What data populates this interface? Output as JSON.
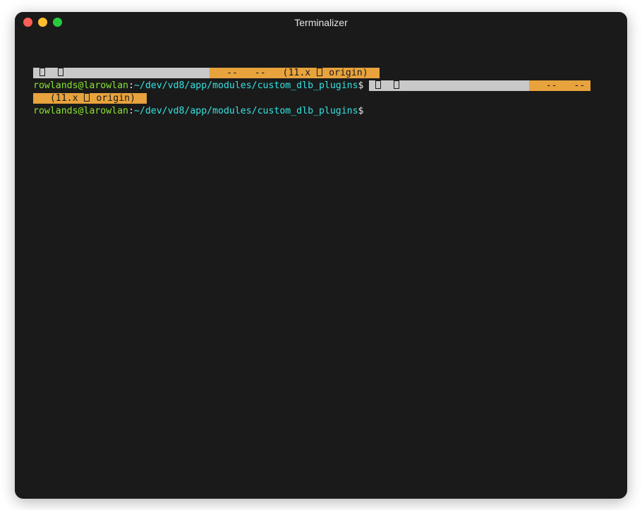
{
  "window": {
    "title": "Terminalizer"
  },
  "colors": {
    "bg_gray": "#c9c9c9",
    "bg_orange": "#e8a33d",
    "fg_green": "#8ae234",
    "fg_cyan": "#34e2e2",
    "fg_white": "#e6e6e6",
    "terminal_bg": "#1a1a1a"
  },
  "lines": [
    {
      "id": "status-line-1",
      "segments": [
        {
          "cls": "bg-gray",
          "text": " ▯  "
        },
        {
          "cls": "bg-gray",
          "text": "▯                          "
        },
        {
          "cls": "bg-orange",
          "text": " "
        },
        {
          "cls": "bg-orange",
          "text": "  --   --   (11.x ▯ origin)  "
        }
      ]
    },
    {
      "id": "prompt-line-1",
      "segments": [
        {
          "cls": "fg-green",
          "text": "rowlands@larowlan"
        },
        {
          "cls": "fg-white",
          "text": ":"
        },
        {
          "cls": "fg-cyan",
          "text": "~/dev/vd8/app/modules/custom_dlb_plugins"
        },
        {
          "cls": "fg-white",
          "text": "$ "
        },
        {
          "cls": "bg-gray",
          "text": " ▯  ▯                       "
        },
        {
          "cls": "bg-orange",
          "text": " "
        },
        {
          "cls": "bg-orange",
          "text": "  --   -- "
        }
      ]
    },
    {
      "id": "status-line-2",
      "segments": [
        {
          "cls": "bg-orange",
          "text": "   (11.x ▯ origin)  "
        }
      ]
    },
    {
      "id": "prompt-line-2",
      "segments": [
        {
          "cls": "fg-green",
          "text": "rowlands@larowlan"
        },
        {
          "cls": "fg-white",
          "text": ":"
        },
        {
          "cls": "fg-cyan",
          "text": "~/dev/vd8/app/modules/custom_dlb_plugins"
        },
        {
          "cls": "fg-white",
          "text": "$ "
        }
      ]
    }
  ]
}
